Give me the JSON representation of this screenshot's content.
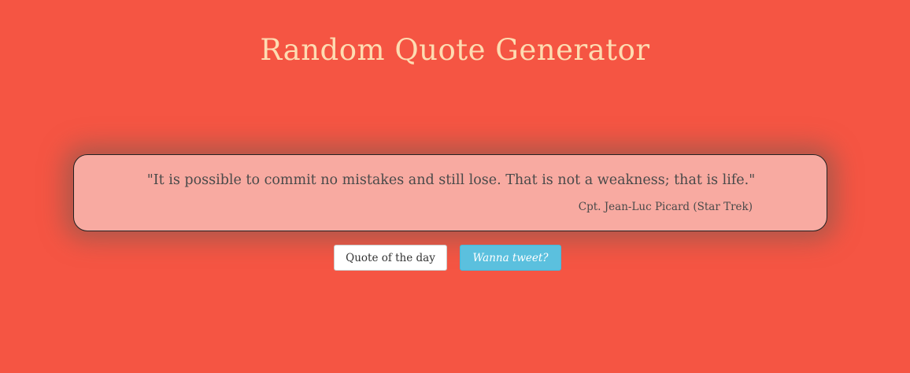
{
  "header": {
    "title": "Random Quote Generator"
  },
  "quote": {
    "text": "\"It is possible to commit no mistakes and still lose. That is not a weakness; that is life.\"",
    "author": "Cpt. Jean-Luc Picard (Star Trek)"
  },
  "actions": {
    "quote_of_day_label": "Quote of the day",
    "tweet_label": "Wanna tweet?"
  },
  "colors": {
    "background": "#f55543",
    "title": "#fddcb2",
    "card": "#f8aaa1",
    "tweet_button": "#5bc0de"
  }
}
